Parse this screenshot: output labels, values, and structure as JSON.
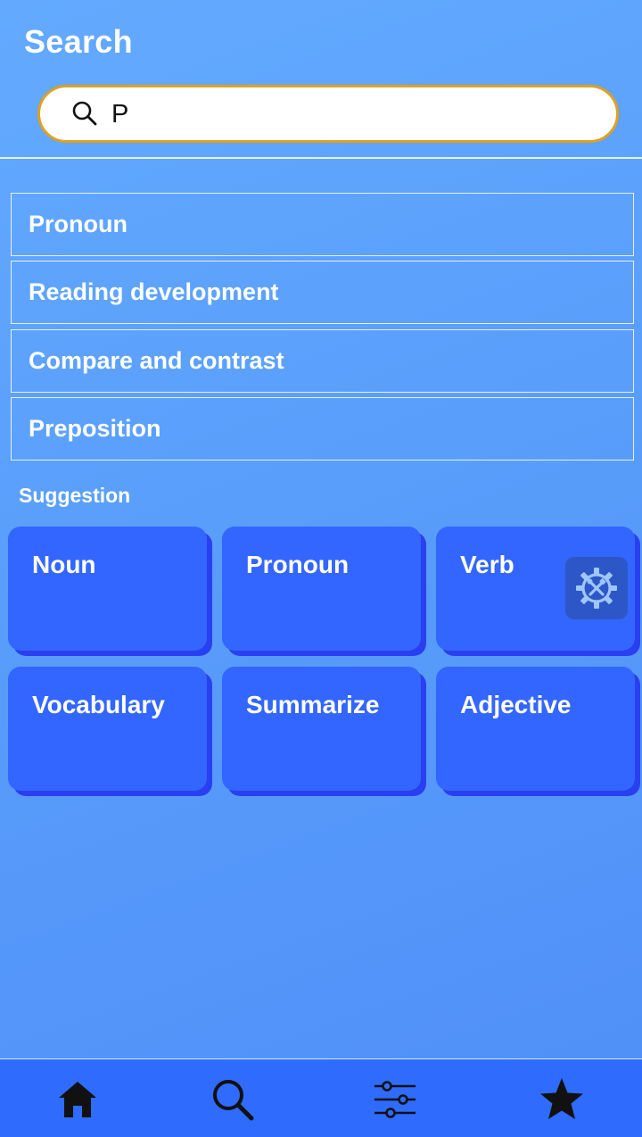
{
  "header": {
    "title": "Search"
  },
  "search": {
    "value": "P",
    "icon": "search-icon"
  },
  "results": [
    {
      "label": "Pronoun"
    },
    {
      "label": "Reading development"
    },
    {
      "label": "Compare and contrast"
    },
    {
      "label": "Preposition"
    }
  ],
  "suggestion": {
    "label": "Suggestion",
    "cards": [
      {
        "label": "Noun"
      },
      {
        "label": "Pronoun"
      },
      {
        "label": "Verb"
      },
      {
        "label": "Vocabulary"
      },
      {
        "label": "Summarize"
      },
      {
        "label": "Adjective"
      }
    ]
  },
  "floating_badge": {
    "icon": "gear-tools-icon"
  },
  "bottom_nav": {
    "items": [
      {
        "icon": "home-icon"
      },
      {
        "icon": "search-icon"
      },
      {
        "icon": "sliders-icon"
      },
      {
        "icon": "star-icon"
      }
    ]
  },
  "colors": {
    "background": "#5a9ffb",
    "card": "#3366ff",
    "card_shadow": "#2a3ff0",
    "search_border": "#e0a11d",
    "nav_bar": "#2f6bfd"
  }
}
